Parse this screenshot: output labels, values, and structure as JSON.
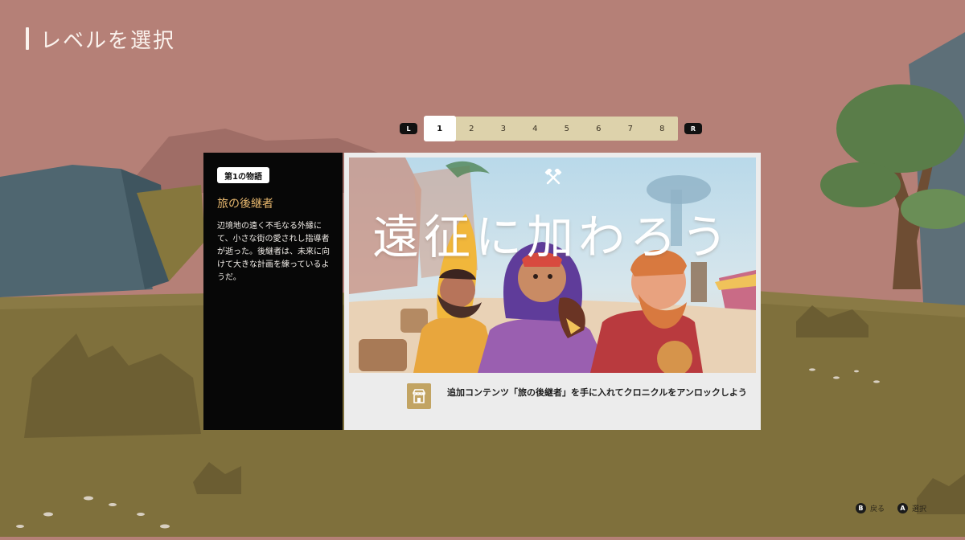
{
  "screen": {
    "title": "レベルを選択"
  },
  "level_tabs": {
    "left_shoulder": "L",
    "right_shoulder": "R",
    "items": [
      "1",
      "2",
      "3",
      "4",
      "5",
      "6",
      "7",
      "8"
    ],
    "selected": "1"
  },
  "story": {
    "chapter_label": "第1の物語",
    "title": "旅の後継者",
    "description": "辺境地の遠く不毛なる外縁にて、小さな街の愛されし指導者が逝った。後継者は、未来に向けて大きな計画を練っているようだ。"
  },
  "dlc_card": {
    "headline": "遠征に加わろう",
    "art_icon": "crossed-hammers-icon",
    "store_icon": "store-icon",
    "unlock_message": "追加コンテンツ「旅の後継者」を手に入れてクロニクルをアンロックしよう"
  },
  "footer": {
    "back_button": "B",
    "back_label": "戻る",
    "select_button": "A",
    "select_label": "選択"
  },
  "colors": {
    "sky": "#b58077",
    "ground": "#8a7a45",
    "panel": "#070707",
    "accent_gold": "#e8b86e",
    "tab_strip": "#ddd2ab",
    "store_gold": "#c2a463"
  }
}
